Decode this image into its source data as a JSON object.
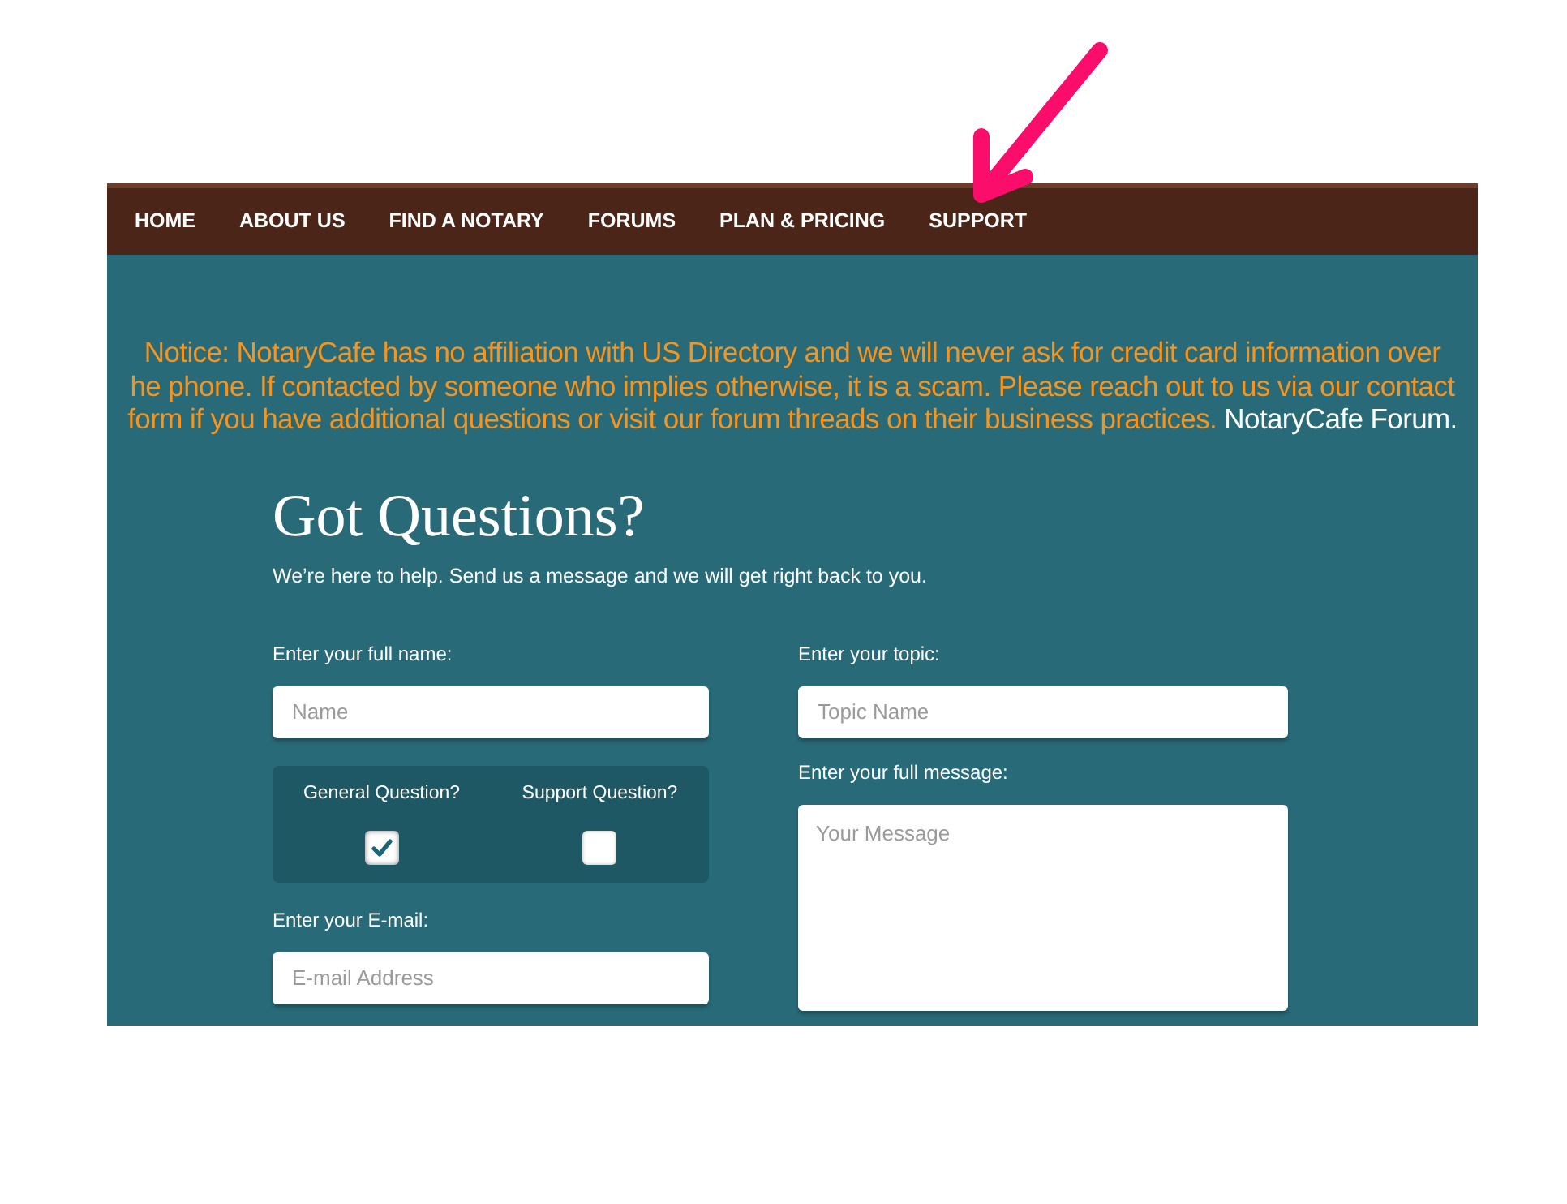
{
  "nav": {
    "items": [
      {
        "label": "HOME"
      },
      {
        "label": "ABOUT US"
      },
      {
        "label": "FIND A NOTARY"
      },
      {
        "label": "FORUMS"
      },
      {
        "label": "PLAN & PRICING"
      },
      {
        "label": "SUPPORT"
      }
    ]
  },
  "notice": {
    "lines": [
      "Notice: NotaryCafe has no affiliation with US Directory and we will never ask for credit card information over",
      "he phone. If contacted by someone who implies otherwise, it is a scam. Please reach out to us via our contact",
      "form if you have additional questions or visit our forum threads on their business practices."
    ],
    "link": "NotaryCafe Forum."
  },
  "contact_form": {
    "title": "Got Questions?",
    "subtitle": "We’re here to help. Send us a message and we will get right back to you.",
    "name_field": {
      "label": "Enter your full name:",
      "placeholder": "Name"
    },
    "topic_field": {
      "label": "Enter your topic:",
      "placeholder": "Topic Name"
    },
    "question_types": [
      {
        "label": "General Question?",
        "checked": true
      },
      {
        "label": "Support Question?",
        "checked": false
      }
    ],
    "message_field": {
      "label": "Enter your full message:",
      "placeholder": "Your Message"
    },
    "email_field": {
      "label": "Enter your E-mail:",
      "placeholder": "E-mail Address"
    }
  }
}
